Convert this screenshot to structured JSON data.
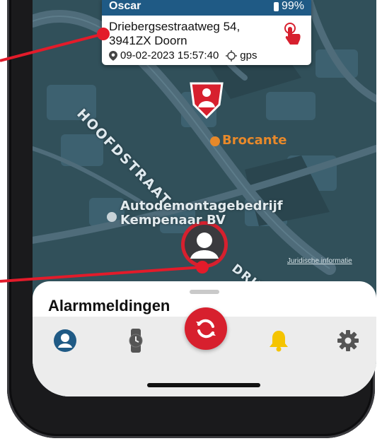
{
  "card": {
    "name": "Oscar",
    "battery": "99%",
    "address_line1": "Driebergsestraatweg 54,",
    "address_line2": "3941ZX Doorn",
    "timestamp": "09-02-2023 15:57:40",
    "source": "gps"
  },
  "map": {
    "street_main": "HOOFDSTRAAT",
    "street_partial": "DRIE",
    "poi_brocante": "Brocante",
    "poi_garage_line1": "Autodemontagebedrijf",
    "poi_garage_line2": "Kempenaar BV",
    "legal_link": "Juridische informatie"
  },
  "sheet": {
    "title": "Alarmmeldingen"
  },
  "tabs": [
    {
      "icon": "person-icon",
      "active": true
    },
    {
      "icon": "watch-icon",
      "active": false
    },
    {
      "icon": "sync-icon",
      "active": false
    },
    {
      "icon": "bell-icon",
      "active": false
    },
    {
      "icon": "gear-icon",
      "active": false
    }
  ],
  "colors": {
    "accent_red": "#d7202e",
    "header_blue": "#1f5a85",
    "poi_orange": "#e8892a",
    "bell_yellow": "#f5c400",
    "active_blue": "#1f5a85"
  }
}
